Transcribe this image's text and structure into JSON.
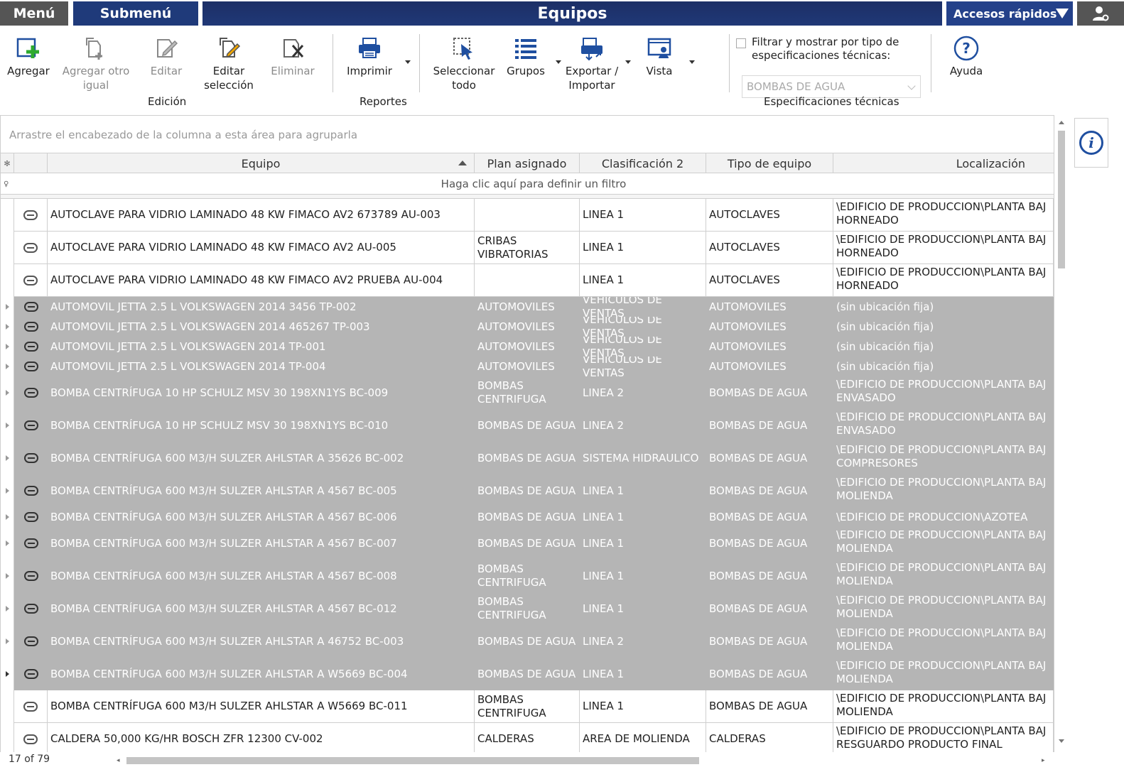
{
  "topbar": {
    "menu": "Menú",
    "submenu": "Submenú",
    "title": "Equipos",
    "quick_access": "Accesos rápidos"
  },
  "ribbon": {
    "buttons": {
      "add": "Agregar",
      "add_same": "Agregar otro\nigual",
      "edit": "Editar",
      "edit_selection": "Editar\nselección",
      "delete": "Eliminar",
      "print": "Imprimir",
      "select_all": "Seleccionar\ntodo",
      "groups": "Grupos",
      "export_import": "Exportar /\nImportar",
      "view": "Vista",
      "help": "Ayuda"
    },
    "groups": {
      "edition": "Edición",
      "reports": "Reportes",
      "specs": "Especificaciones técnicas"
    },
    "filter_checkbox_label": "Filtrar y mostrar por tipo de especificaciones técnicas:",
    "spec_select_value": "BOMBAS DE AGUA"
  },
  "grid": {
    "group_panel_hint": "Arrastre el encabezado de la columna a esta área para agruparla",
    "filter_hint": "Haga clic aquí para definir un filtro",
    "columns": {
      "equipo": "Equipo",
      "plan": "Plan asignado",
      "clas2": "Clasificación 2",
      "tipo": "Tipo de equipo",
      "loc": "Localización"
    },
    "rows": [
      {
        "equipo": "AUTOCLAVE PARA VIDRIO LAMINADO 48 KW FIMACO AV2 673789 AU-003",
        "plan": "",
        "clas2": "LINEA 1",
        "tipo": "AUTOCLAVES",
        "loc": "\\EDIFICIO DE PRODUCCION\\PLANTA BAJ\nHORNEADO"
      },
      {
        "equipo": "AUTOCLAVE PARA VIDRIO LAMINADO 48 KW FIMACO AV2 AU-005",
        "plan": "CRIBAS\nVIBRATORIAS",
        "clas2": "LINEA 1",
        "tipo": "AUTOCLAVES",
        "loc": "\\EDIFICIO DE PRODUCCION\\PLANTA BAJ\nHORNEADO"
      },
      {
        "equipo": "AUTOCLAVE PARA VIDRIO LAMINADO 48 KW FIMACO AV2 PRUEBA AU-004",
        "plan": "",
        "clas2": "LINEA 1",
        "tipo": "AUTOCLAVES",
        "loc": "\\EDIFICIO DE PRODUCCION\\PLANTA BAJ\nHORNEADO"
      },
      {
        "equipo": "AUTOMOVIL JETTA 2.5 L VOLKSWAGEN 2014 3456 TP-002",
        "plan": "AUTOMOVILES",
        "clas2": "VEHICULOS DE VENTAS",
        "tipo": "AUTOMOVILES",
        "loc": "(sin ubicación fija)"
      },
      {
        "equipo": "AUTOMOVIL JETTA 2.5 L VOLKSWAGEN 2014 465267 TP-003",
        "plan": "AUTOMOVILES",
        "clas2": "VEHICULOS DE VENTAS",
        "tipo": "AUTOMOVILES",
        "loc": "(sin ubicación fija)"
      },
      {
        "equipo": "AUTOMOVIL JETTA 2.5 L VOLKSWAGEN 2014 TP-001",
        "plan": "AUTOMOVILES",
        "clas2": "VEHICULOS DE VENTAS",
        "tipo": "AUTOMOVILES",
        "loc": "(sin ubicación fija)"
      },
      {
        "equipo": "AUTOMOVIL JETTA 2.5 L VOLKSWAGEN 2014 TP-004",
        "plan": "AUTOMOVILES",
        "clas2": "VEHICULOS DE VENTAS",
        "tipo": "AUTOMOVILES",
        "loc": "(sin ubicación fija)"
      },
      {
        "equipo": "BOMBA CENTRÍFUGA 10 HP SCHULZ MSV 30 198XN1YS BC-009",
        "plan": "BOMBAS\nCENTRIFUGA",
        "clas2": "LINEA 2",
        "tipo": "BOMBAS DE AGUA",
        "loc": "\\EDIFICIO DE PRODUCCION\\PLANTA BAJ\nENVASADO"
      },
      {
        "equipo": "BOMBA CENTRÍFUGA 10 HP SCHULZ MSV 30 198XN1YS BC-010",
        "plan": "BOMBAS DE AGUA",
        "clas2": "LINEA 2",
        "tipo": "BOMBAS DE AGUA",
        "loc": "\\EDIFICIO DE PRODUCCION\\PLANTA BAJ\nENVASADO"
      },
      {
        "equipo": "BOMBA CENTRÍFUGA 600 M3/H SULZER AHLSTAR A 35626 BC-002",
        "plan": "BOMBAS DE AGUA",
        "clas2": "SISTEMA HIDRAULICO",
        "tipo": "BOMBAS DE AGUA",
        "loc": "\\EDIFICIO DE PRODUCCION\\PLANTA BAJ\nCOMPRESORES"
      },
      {
        "equipo": "BOMBA CENTRÍFUGA 600 M3/H SULZER AHLSTAR A 4567 BC-005",
        "plan": "BOMBAS DE AGUA",
        "clas2": "LINEA 1",
        "tipo": "BOMBAS DE AGUA",
        "loc": "\\EDIFICIO DE PRODUCCION\\PLANTA BAJ\nMOLIENDA"
      },
      {
        "equipo": "BOMBA CENTRÍFUGA 600 M3/H SULZER AHLSTAR A 4567 BC-006",
        "plan": "BOMBAS DE AGUA",
        "clas2": "LINEA 1",
        "tipo": "BOMBAS DE AGUA",
        "loc": "\\EDIFICIO DE PRODUCCION\\AZOTEA"
      },
      {
        "equipo": "BOMBA CENTRÍFUGA 600 M3/H SULZER AHLSTAR A 4567 BC-007",
        "plan": "BOMBAS DE AGUA",
        "clas2": "LINEA 1",
        "tipo": "BOMBAS DE AGUA",
        "loc": "\\EDIFICIO DE PRODUCCION\\PLANTA BAJ\nMOLIENDA"
      },
      {
        "equipo": "BOMBA CENTRÍFUGA 600 M3/H SULZER AHLSTAR A 4567 BC-008",
        "plan": "BOMBAS\nCENTRIFUGA",
        "clas2": "LINEA 1",
        "tipo": "BOMBAS DE AGUA",
        "loc": "\\EDIFICIO DE PRODUCCION\\PLANTA BAJ\nMOLIENDA"
      },
      {
        "equipo": "BOMBA CENTRÍFUGA 600 M3/H SULZER AHLSTAR A 4567 BC-012",
        "plan": "BOMBAS\nCENTRIFUGA",
        "clas2": "LINEA 1",
        "tipo": "BOMBAS DE AGUA",
        "loc": "\\EDIFICIO DE PRODUCCION\\PLANTA BAJ\nMOLIENDA"
      },
      {
        "equipo": "BOMBA CENTRÍFUGA 600 M3/H SULZER AHLSTAR A 46752 BC-003",
        "plan": "BOMBAS DE AGUA",
        "clas2": "LINEA 2",
        "tipo": "BOMBAS DE AGUA",
        "loc": "\\EDIFICIO DE PRODUCCION\\PLANTA BAJ\nMOLIENDA"
      },
      {
        "equipo": "BOMBA CENTRÍFUGA 600 M3/H SULZER AHLSTAR A W5669 BC-004",
        "plan": "BOMBAS DE AGUA",
        "clas2": "LINEA 1",
        "tipo": "BOMBAS DE AGUA",
        "loc": "\\EDIFICIO DE PRODUCCION\\PLANTA BAJ\nMOLIENDA"
      },
      {
        "equipo": "BOMBA CENTRÍFUGA 600 M3/H SULZER AHLSTAR A W5669 BC-011",
        "plan": "BOMBAS\nCENTRIFUGA",
        "clas2": "LINEA 1",
        "tipo": "BOMBAS DE AGUA",
        "loc": "\\EDIFICIO DE PRODUCCION\\PLANTA BAJ\nMOLIENDA"
      },
      {
        "equipo": "CALDERA 50,000 KG/HR BOSCH ZFR 12300 CV-002",
        "plan": "CALDERAS",
        "clas2": "AREA DE MOLIENDA",
        "tipo": "CALDERAS",
        "loc": "\\EDIFICIO DE PRODUCCION\\PLANTA BAJ\nRESGUARDO PRODUCTO FINAL"
      }
    ],
    "selected_rows": [
      3,
      4,
      5,
      6,
      7,
      8,
      9,
      10,
      11,
      12,
      13,
      14,
      15,
      16
    ],
    "record_count": "17 of 79"
  }
}
